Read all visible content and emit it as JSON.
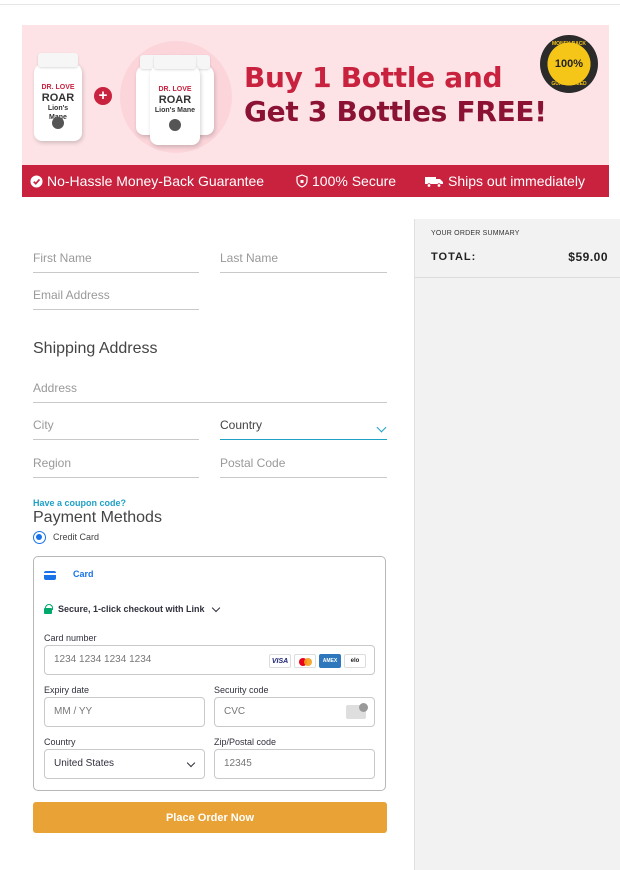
{
  "banner": {
    "headline_line1": "Buy 1 Bottle and",
    "headline_line2": "Get 3 Bottles FREE!",
    "plus_sign": "+",
    "bottle_brand": "DR. LOVE",
    "bottle_name": "ROAR",
    "bottle_sub": "Lion's Mane",
    "seal_percent": "100%",
    "seal_text_top": "MONEY BACK",
    "seal_text_bottom": "GUARANTEED",
    "guarantee": "No-Hassle Money-Back Guarantee",
    "secure": "100% Secure",
    "shipping": "Ships out immediately",
    "colors": {
      "accent": "#c8223e",
      "background": "#fde3e6",
      "headline_dark": "#8b1232"
    }
  },
  "form": {
    "first_name_placeholder": "First Name",
    "last_name_placeholder": "Last Name",
    "email_placeholder": "Email Address",
    "shipping_title": "Shipping Address",
    "address_placeholder": "Address",
    "city_placeholder": "City",
    "country_value": "Country",
    "region_placeholder": "Region",
    "postal_placeholder": "Postal Code",
    "coupon_link": "Have a coupon code?",
    "payment_title": "Payment Methods",
    "payment_option": "Credit Card"
  },
  "card": {
    "tab_label": "Card",
    "link_text": "Secure, 1-click checkout with Link",
    "number_label": "Card number",
    "number_placeholder": "1234 1234 1234 1234",
    "brands": [
      "VISA",
      "MC",
      "AMEX",
      "elo"
    ],
    "expiry_label": "Expiry date",
    "expiry_placeholder": "MM / YY",
    "cvc_label": "Security code",
    "cvc_placeholder": "CVC",
    "country_label": "Country",
    "country_value": "United States",
    "zip_label": "Zip/Postal code",
    "zip_placeholder": "12345"
  },
  "actions": {
    "place_order": "Place Order Now",
    "button_color": "#e8a236"
  },
  "summary": {
    "title": "YOUR ORDER SUMMARY",
    "total_label": "TOTAL:",
    "total_value": "$59.00"
  }
}
